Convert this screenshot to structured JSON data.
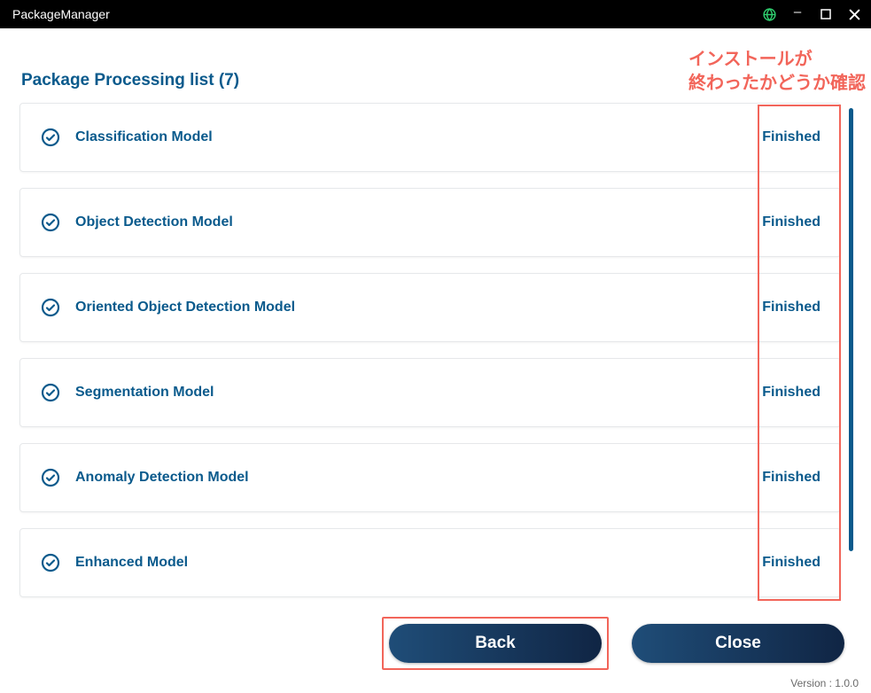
{
  "titlebar": {
    "title": "PackageManager"
  },
  "header": {
    "list_title": "Package Processing list (7)"
  },
  "annotations": {
    "install_check": "インストールが\n終わったかどうか確認"
  },
  "packages": [
    {
      "name": "Classification Model",
      "status": "Finished"
    },
    {
      "name": "Object Detection Model",
      "status": "Finished"
    },
    {
      "name": "Oriented Object Detection Model",
      "status": "Finished"
    },
    {
      "name": "Segmentation Model",
      "status": "Finished"
    },
    {
      "name": "Anomaly Detection Model",
      "status": "Finished"
    },
    {
      "name": "Enhanced Model",
      "status": "Finished"
    }
  ],
  "buttons": {
    "back": "Back",
    "close": "Close"
  },
  "version": "Version : 1.0.0",
  "colors": {
    "brand": "#0a5a8c",
    "annotation": "#f2655a",
    "globe": "#2fcf6f"
  }
}
